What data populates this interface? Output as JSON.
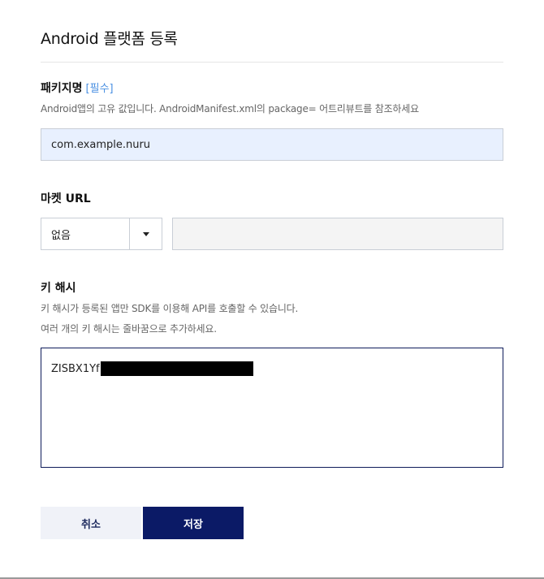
{
  "dialog": {
    "title": "Android 플랫폼 등록"
  },
  "package": {
    "label": "패키지명",
    "required": "[필수]",
    "help": "Android앱의 고유 값입니다. AndroidManifest.xml의 package= 어트리뷰트를 참조하세요",
    "value": "com.example.nuru"
  },
  "market": {
    "label": "마켓 URL",
    "select_value": "없음",
    "url_value": ""
  },
  "keyhash": {
    "label": "키 해시",
    "help_line1": "키 해시가 등록된 앱만 SDK를 이용해 API를 호출할 수 있습니다.",
    "help_line2": "여러 개의 키 해시는 줄바꿈으로 추가하세요.",
    "value_visible": "ZISBX1Yf"
  },
  "buttons": {
    "cancel": "취소",
    "save": "저장"
  },
  "colors": {
    "primary": "#0b1a66",
    "autofill_bg": "#e8f0fe",
    "required": "#4a90e2"
  }
}
